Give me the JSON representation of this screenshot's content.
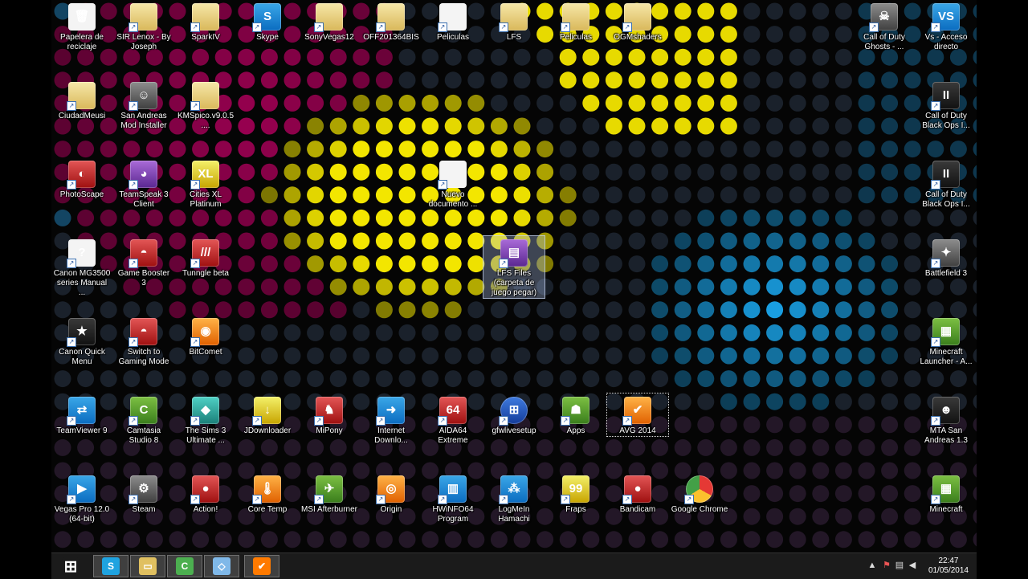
{
  "desktop_icons": [
    {
      "label": "Papelera de reciclaje",
      "icon": "recycle-bin-icon",
      "glyph": "🗑",
      "style": "doc"
    },
    {
      "label": "SIR Lenox - By Joseph",
      "icon": "shortcut-folder-icon",
      "glyph": "",
      "style": "folder"
    },
    {
      "label": "SparkIV",
      "icon": "folder-icon",
      "glyph": "",
      "style": "folder"
    },
    {
      "label": "Skype",
      "icon": "skype-icon",
      "glyph": "S",
      "style": "blue"
    },
    {
      "label": "SonyVegas12",
      "icon": "folder-icon",
      "glyph": "",
      "style": "folder"
    },
    {
      "label": "OFF201364BIS",
      "icon": "folder-icon",
      "glyph": "",
      "style": "folder"
    },
    {
      "label": "Peliculas",
      "icon": "document-icon",
      "glyph": "",
      "style": "doc"
    },
    {
      "label": "LFS",
      "icon": "folder-icon",
      "glyph": "",
      "style": "folder"
    },
    {
      "label": "Peliculas",
      "icon": "folder-icon",
      "glyph": "",
      "style": "folder"
    },
    {
      "label": "OGMshaders",
      "icon": "folder-icon",
      "glyph": "",
      "style": "folder"
    },
    {
      "label": "Call of Duty Ghosts - ...",
      "icon": "ghosts-mask-icon",
      "glyph": "☠",
      "style": "gray"
    },
    {
      "label": "Vs - Acceso directo",
      "icon": "vs-shortcut-icon",
      "glyph": "VS",
      "style": "blue"
    },
    {
      "label": "CiudadMeusi",
      "icon": "folder-icon",
      "glyph": "",
      "style": "folder"
    },
    {
      "label": "San Andreas Mod Installer",
      "icon": "san-andreas-mod-installer-icon",
      "glyph": "☺",
      "style": "gray"
    },
    {
      "label": "KMSpico.v9.0.5....",
      "icon": "folder-icon",
      "glyph": "",
      "style": "folder"
    },
    {
      "label": "Call of Duty Black Ops I...",
      "icon": "black-ops-icon",
      "glyph": "II",
      "style": "dark"
    },
    {
      "label": "PhotoScape",
      "icon": "photoscape-icon",
      "glyph": "◐",
      "style": "red"
    },
    {
      "label": "TeamSpeak 3 Client",
      "icon": "teamspeak-icon",
      "glyph": "◕",
      "style": "purple"
    },
    {
      "label": "Cities XL Platinum",
      "icon": "cities-xl-icon",
      "glyph": "XL",
      "style": "yellow"
    },
    {
      "label": "Nuevo documento ...",
      "icon": "new-document-icon",
      "glyph": "",
      "style": "doc"
    },
    {
      "label": "Call of Duty Black Ops I...",
      "icon": "black-ops-icon",
      "glyph": "II",
      "style": "dark"
    },
    {
      "label": "Canon MG3500 series Manual ...",
      "icon": "canon-manual-icon",
      "glyph": "?",
      "style": "doc"
    },
    {
      "label": "Game Booster 3",
      "icon": "game-booster-icon",
      "glyph": "◓",
      "style": "red"
    },
    {
      "label": "Tunngle beta",
      "icon": "tunngle-icon",
      "glyph": "///",
      "style": "red"
    },
    {
      "label": "LFS Files (carpeta de juego pegar)",
      "icon": "winrar-archive-icon",
      "glyph": "▤",
      "style": "purple"
    },
    {
      "label": "Battlefield 3",
      "icon": "battlefield-icon",
      "glyph": "✦",
      "style": "gray"
    },
    {
      "label": "Canon Quick Menu",
      "icon": "canon-quick-menu-icon",
      "glyph": "★",
      "style": "dark"
    },
    {
      "label": "Switch to Gaming Mode",
      "icon": "gaming-mode-icon",
      "glyph": "◓",
      "style": "red"
    },
    {
      "label": "BitComet",
      "icon": "bitcomet-icon",
      "glyph": "◉",
      "style": "orange"
    },
    {
      "label": "Minecraft Launcher - A...",
      "icon": "minecraft-launcher-icon",
      "glyph": "▦",
      "style": "green"
    },
    {
      "label": "TeamViewer 9",
      "icon": "teamviewer-icon",
      "glyph": "⇄",
      "style": "blue"
    },
    {
      "label": "Camtasia Studio 8",
      "icon": "camtasia-icon",
      "glyph": "C",
      "style": "green"
    },
    {
      "label": "The Sims 3 Ultimate ...",
      "icon": "sims-icon",
      "glyph": "◆",
      "style": "teal"
    },
    {
      "label": "JDownloader",
      "icon": "jdownloader-icon",
      "glyph": "↓",
      "style": "yellow"
    },
    {
      "label": "MiPony",
      "icon": "mipony-icon",
      "glyph": "♞",
      "style": "red"
    },
    {
      "label": "Internet Downlo...",
      "icon": "internet-download-manager-icon",
      "glyph": "➜",
      "style": "blue"
    },
    {
      "label": "AIDA64 Extreme",
      "icon": "aida64-icon",
      "glyph": "64",
      "style": "red"
    },
    {
      "label": "gfwlivesetup",
      "icon": "windows-live-icon",
      "glyph": "⊞",
      "style": "win"
    },
    {
      "label": "Apps",
      "icon": "android-apps-icon",
      "glyph": "☗",
      "style": "green"
    },
    {
      "label": "AVG 2014",
      "icon": "avg-icon",
      "glyph": "✔",
      "style": "orange"
    },
    {
      "label": "MTA San Andreas 1.3",
      "icon": "mta-icon",
      "glyph": "☻",
      "style": "dark"
    },
    {
      "label": "Vegas Pro 12.0 (64-bit)",
      "icon": "vegas-pro-icon",
      "glyph": "▶",
      "style": "blue"
    },
    {
      "label": "Steam",
      "icon": "steam-icon",
      "glyph": "⚙",
      "style": "gray"
    },
    {
      "label": "Action!",
      "icon": "action-recorder-icon",
      "glyph": "●",
      "style": "red"
    },
    {
      "label": "Core Temp",
      "icon": "core-temp-icon",
      "glyph": "🌡",
      "style": "orange"
    },
    {
      "label": "MSI Afterburner",
      "icon": "msi-afterburner-icon",
      "glyph": "✈",
      "style": "green"
    },
    {
      "label": "Origin",
      "icon": "origin-icon",
      "glyph": "◎",
      "style": "orange"
    },
    {
      "label": "HWiNFO64 Program",
      "icon": "hwinfo-icon",
      "glyph": "▥",
      "style": "blue"
    },
    {
      "label": "LogMeIn Hamachi",
      "icon": "hamachi-icon",
      "glyph": "⁂",
      "style": "blue"
    },
    {
      "label": "Fraps",
      "icon": "fraps-icon",
      "glyph": "99",
      "style": "yellow"
    },
    {
      "label": "Bandicam",
      "icon": "bandicam-icon",
      "glyph": "●",
      "style": "red"
    },
    {
      "label": "Google Chrome",
      "icon": "chrome-icon",
      "glyph": "",
      "style": "chrome"
    },
    {
      "label": "Minecraft",
      "icon": "minecraft-icon",
      "glyph": "▦",
      "style": "green"
    }
  ],
  "taskbar": {
    "items": [
      {
        "name": "start-button",
        "icon": "windows-logo-icon",
        "glyph": "⊞",
        "color": "#1b1b1b"
      },
      {
        "name": "taskbar-skype",
        "icon": "skype-icon",
        "glyph": "S",
        "color": "#1fa3e0"
      },
      {
        "name": "taskbar-file-explorer",
        "icon": "file-explorer-icon",
        "glyph": "▭",
        "color": "#e0c060"
      },
      {
        "name": "taskbar-camtasia",
        "icon": "camtasia-icon",
        "glyph": "C",
        "color": "#4caf50"
      },
      {
        "name": "taskbar-app",
        "icon": "app-icon",
        "glyph": "◇",
        "color": "#7fb8e8"
      },
      {
        "name": "taskbar-avg",
        "icon": "avg-icon",
        "glyph": "✔",
        "color": "#ff7a00"
      }
    ],
    "tray": {
      "chevron": "▲",
      "flag": "⚑",
      "network": "▤",
      "volume": "◀"
    },
    "clock": {
      "time": "22:47",
      "date": "01/05/2014"
    }
  }
}
